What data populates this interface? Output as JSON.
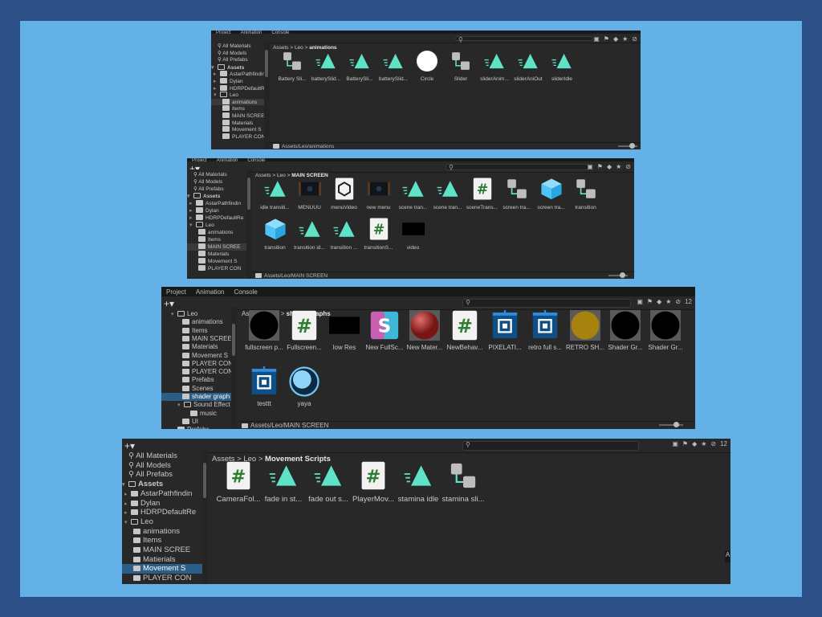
{
  "panels": [
    {
      "tabs": [
        "Project",
        "Animation",
        "Console"
      ],
      "tree": [
        {
          "label": "All Materials",
          "kind": "search"
        },
        {
          "label": "All Models",
          "kind": "search"
        },
        {
          "label": "All Prefabs",
          "kind": "search"
        },
        {
          "label": "Assets",
          "kind": "root"
        },
        {
          "label": "AstarPathfindin",
          "kind": "folder"
        },
        {
          "label": "Dylan",
          "kind": "folder"
        },
        {
          "label": "HDRPDefaultRe",
          "kind": "folder"
        },
        {
          "label": "Leo",
          "kind": "open"
        },
        {
          "label": "animations",
          "kind": "sub",
          "selected": true
        },
        {
          "label": "Items",
          "kind": "sub"
        },
        {
          "label": "MAIN SCREE",
          "kind": "sub"
        },
        {
          "label": "Materials",
          "kind": "sub"
        },
        {
          "label": "Movement S",
          "kind": "sub"
        },
        {
          "label": "PLAYER CON",
          "kind": "sub"
        }
      ],
      "breadcrumb": [
        "Assets",
        "Leo",
        "animations"
      ],
      "assets": [
        {
          "label": "Battery Sli...",
          "icon": "controller"
        },
        {
          "label": "batterySlid...",
          "icon": "anim"
        },
        {
          "label": "BatterySli...",
          "icon": "anim"
        },
        {
          "label": "batterySlid...",
          "icon": "anim"
        },
        {
          "label": "Circle",
          "icon": "white-circle"
        },
        {
          "label": "Slider",
          "icon": "controller"
        },
        {
          "label": "sliderAnim...",
          "icon": "anim"
        },
        {
          "label": "sliderAniOut",
          "icon": "anim"
        },
        {
          "label": "sliderIdle",
          "icon": "anim"
        }
      ],
      "footer": "Assets/Leo/animations"
    },
    {
      "tabs": [
        "Project",
        "Animation",
        "Console"
      ],
      "tree": [
        {
          "label": "All Materials",
          "kind": "search"
        },
        {
          "label": "All Models",
          "kind": "search"
        },
        {
          "label": "All Prefabs",
          "kind": "search"
        },
        {
          "label": "Assets",
          "kind": "root"
        },
        {
          "label": "AstarPathfindin",
          "kind": "folder"
        },
        {
          "label": "Dylan",
          "kind": "folder"
        },
        {
          "label": "HDRPDefaultRe",
          "kind": "folder"
        },
        {
          "label": "Leo",
          "kind": "open"
        },
        {
          "label": "animations",
          "kind": "sub"
        },
        {
          "label": "Items",
          "kind": "sub"
        },
        {
          "label": "MAIN SCREE",
          "kind": "sub",
          "selected": true
        },
        {
          "label": "Materials",
          "kind": "sub"
        },
        {
          "label": "Movement S",
          "kind": "sub"
        },
        {
          "label": "PLAYER CON",
          "kind": "sub"
        }
      ],
      "breadcrumb": [
        "Assets",
        "Leo",
        "MAIN SCREEN"
      ],
      "assets": [
        {
          "label": "idle transiti...",
          "icon": "anim"
        },
        {
          "label": "MENUUU",
          "icon": "video-thumb"
        },
        {
          "label": "menuVideo",
          "icon": "unity"
        },
        {
          "label": "new menu",
          "icon": "video-thumb"
        },
        {
          "label": "scene tran...",
          "icon": "anim"
        },
        {
          "label": "scene tran...",
          "icon": "anim"
        },
        {
          "label": "sceneTrans...",
          "icon": "script"
        },
        {
          "label": "screen tra...",
          "icon": "controller"
        },
        {
          "label": "screen tra...",
          "icon": "cube"
        },
        {
          "label": "transition",
          "icon": "controller"
        },
        {
          "label": "transition",
          "icon": "cube"
        },
        {
          "label": "transition id...",
          "icon": "anim"
        },
        {
          "label": "transition ...",
          "icon": "anim"
        },
        {
          "label": "transitionS...",
          "icon": "script"
        },
        {
          "label": "video",
          "icon": "black-rect"
        }
      ],
      "footer": "Assets/Leo/MAIN SCREEN"
    },
    {
      "tabs": [
        "Project",
        "Animation",
        "Console"
      ],
      "toolbar_count": "12",
      "tree": [
        {
          "label": "Leo",
          "kind": "open"
        },
        {
          "label": "animations",
          "kind": "sub"
        },
        {
          "label": "Items",
          "kind": "sub"
        },
        {
          "label": "MAIN SCREE",
          "kind": "sub"
        },
        {
          "label": "Materials",
          "kind": "sub"
        },
        {
          "label": "Movement S",
          "kind": "sub"
        },
        {
          "label": "PLAYER CON",
          "kind": "sub"
        },
        {
          "label": "PLAYER CON",
          "kind": "sub"
        },
        {
          "label": "Prefabs",
          "kind": "sub"
        },
        {
          "label": "Scenes",
          "kind": "sub"
        },
        {
          "label": "shader graph",
          "kind": "sub",
          "selected": true
        },
        {
          "label": "Sound Effect",
          "kind": "subopen"
        },
        {
          "label": "music",
          "kind": "subsub"
        },
        {
          "label": "UI",
          "kind": "sub"
        },
        {
          "label": "Prefabs",
          "kind": "folder"
        }
      ],
      "breadcrumb": [
        "Assets",
        "Leo",
        "shader graphs"
      ],
      "assets": [
        {
          "label": "fullscreen p...",
          "icon": "black-circle"
        },
        {
          "label": "Fullscreen...",
          "icon": "script"
        },
        {
          "label": "low Res",
          "icon": "black-rect"
        },
        {
          "label": "New FullSc...",
          "icon": "shadergraph"
        },
        {
          "label": "New Mater...",
          "icon": "red-sphere"
        },
        {
          "label": "NewBehav...",
          "icon": "script"
        },
        {
          "label": "PIXELATI...",
          "icon": "subgraph"
        },
        {
          "label": "retro full s...",
          "icon": "subgraph"
        },
        {
          "label": "RETRO SH...",
          "icon": "gold-circle"
        },
        {
          "label": "Shader Gr...",
          "icon": "black-circle"
        },
        {
          "label": "Shader Gr...",
          "icon": "black-circle"
        },
        {
          "label": "testtt",
          "icon": "subgraph"
        },
        {
          "label": "yaya",
          "icon": "blue-circle"
        }
      ],
      "footer": "Assets/Leo/MAIN SCREEN"
    },
    {
      "toolbar_count": "12",
      "tree": [
        {
          "label": "All Materials",
          "kind": "search"
        },
        {
          "label": "All Models",
          "kind": "search"
        },
        {
          "label": "All Prefabs",
          "kind": "search"
        },
        {
          "label": "Assets",
          "kind": "root"
        },
        {
          "label": "AstarPathfindin",
          "kind": "folder"
        },
        {
          "label": "Dylan",
          "kind": "folder"
        },
        {
          "label": "HDRPDefaultRe",
          "kind": "folder"
        },
        {
          "label": "Leo",
          "kind": "open"
        },
        {
          "label": "animations",
          "kind": "sub"
        },
        {
          "label": "Items",
          "kind": "sub"
        },
        {
          "label": "MAIN SCREE",
          "kind": "sub"
        },
        {
          "label": "Matierials",
          "kind": "sub"
        },
        {
          "label": "Movement S",
          "kind": "sub",
          "selected": true
        },
        {
          "label": "PLAYER CON",
          "kind": "sub"
        }
      ],
      "breadcrumb": [
        "Assets",
        "Leo",
        "Movement Scripts"
      ],
      "assets": [
        {
          "label": "CameraFol...",
          "icon": "script"
        },
        {
          "label": "fade in st...",
          "icon": "anim"
        },
        {
          "label": "fade out s...",
          "icon": "anim"
        },
        {
          "label": "PlayerMov...",
          "icon": "script"
        },
        {
          "label": "stamina idle",
          "icon": "anim"
        },
        {
          "label": "stamina sli...",
          "icon": "controller"
        }
      ],
      "side_letter": "A"
    }
  ],
  "colors": {
    "anim": "#5ee3c6",
    "script_hash": "#2e7d32",
    "cube": "#4fc3f7",
    "selected_blue": "#2c5d87"
  }
}
